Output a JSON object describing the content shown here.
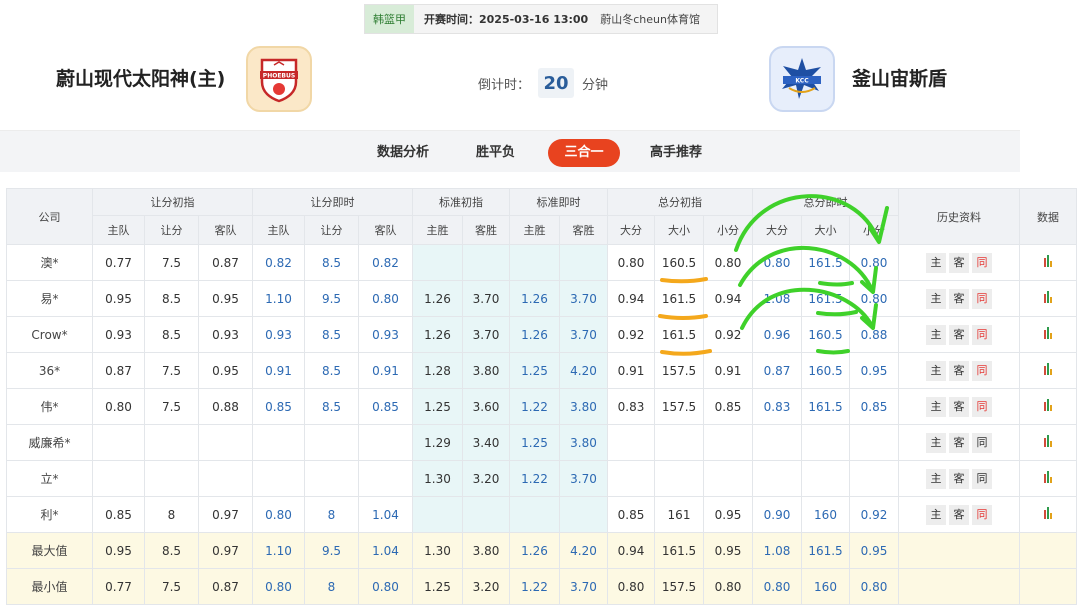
{
  "match": {
    "league": "韩篮甲",
    "start_label": "开赛时间：",
    "start_time": "2025-03-16 13:00",
    "venue": "蔚山冬cheun体育馆"
  },
  "teams": {
    "home": {
      "name": "蔚山现代太阳神(主)",
      "logo_text": "PHOEBUS"
    },
    "away": {
      "name": "釜山宙斯盾",
      "logo_text": "KCC"
    }
  },
  "countdown": {
    "label": "倒计时：",
    "value": "20",
    "unit": "分钟"
  },
  "tabs": [
    {
      "label": "数据分析",
      "active": false
    },
    {
      "label": "胜平负",
      "active": false
    },
    {
      "label": "三合一",
      "active": true
    },
    {
      "label": "高手推荐",
      "active": false
    }
  ],
  "table": {
    "group_headers": {
      "company": "公司",
      "handicap_open": "让分初指",
      "handicap_live": "让分即时",
      "std_open": "标准初指",
      "std_live": "标准即时",
      "total_open": "总分初指",
      "total_live": "总分即时",
      "history": "历史资料",
      "data": "数据"
    },
    "sub_headers": [
      "主队",
      "让分",
      "客队",
      "主队",
      "让分",
      "客队",
      "主胜",
      "客胜",
      "主胜",
      "客胜",
      "大分",
      "大小",
      "小分",
      "大分",
      "大小",
      "小分"
    ],
    "history_buttons": [
      "主",
      "客",
      "同"
    ],
    "rows": [
      {
        "company": "澳*",
        "hc_open": [
          "0.77",
          "7.5",
          "0.87"
        ],
        "hc_live": [
          "0.82",
          "8.5",
          "0.82"
        ],
        "std_open": [
          "",
          ""
        ],
        "std_live": [
          "",
          ""
        ],
        "tot_open": [
          "0.80",
          "160.5",
          "0.80"
        ],
        "tot_live": [
          "0.80",
          "161.5",
          "0.80"
        ],
        "same_active": true
      },
      {
        "company": "易*",
        "hc_open": [
          "0.95",
          "8.5",
          "0.95"
        ],
        "hc_live": [
          "1.10",
          "9.5",
          "0.80"
        ],
        "std_open": [
          "1.26",
          "3.70"
        ],
        "std_live": [
          "1.26",
          "3.70"
        ],
        "tot_open": [
          "0.94",
          "161.5",
          "0.94"
        ],
        "tot_live": [
          "1.08",
          "161.5",
          "0.80"
        ],
        "same_active": true
      },
      {
        "company": "Crow*",
        "hc_open": [
          "0.93",
          "8.5",
          "0.93"
        ],
        "hc_live": [
          "0.93",
          "8.5",
          "0.93"
        ],
        "std_open": [
          "1.26",
          "3.70"
        ],
        "std_live": [
          "1.26",
          "3.70"
        ],
        "tot_open": [
          "0.92",
          "161.5",
          "0.92"
        ],
        "tot_live": [
          "0.96",
          "160.5",
          "0.88"
        ],
        "same_active": true
      },
      {
        "company": "36*",
        "hc_open": [
          "0.87",
          "7.5",
          "0.95"
        ],
        "hc_live": [
          "0.91",
          "8.5",
          "0.91"
        ],
        "std_open": [
          "1.28",
          "3.80"
        ],
        "std_live": [
          "1.25",
          "4.20"
        ],
        "tot_open": [
          "0.91",
          "157.5",
          "0.91"
        ],
        "tot_live": [
          "0.87",
          "160.5",
          "0.95"
        ],
        "same_active": true
      },
      {
        "company": "伟*",
        "hc_open": [
          "0.80",
          "7.5",
          "0.88"
        ],
        "hc_live": [
          "0.85",
          "8.5",
          "0.85"
        ],
        "std_open": [
          "1.25",
          "3.60"
        ],
        "std_live": [
          "1.22",
          "3.80"
        ],
        "tot_open": [
          "0.83",
          "157.5",
          "0.85"
        ],
        "tot_live": [
          "0.83",
          "161.5",
          "0.85"
        ],
        "same_active": true
      },
      {
        "company": "威廉希*",
        "hc_open": [
          "",
          "",
          ""
        ],
        "hc_live": [
          "",
          "",
          ""
        ],
        "std_open": [
          "1.29",
          "3.40"
        ],
        "std_live": [
          "1.25",
          "3.80"
        ],
        "tot_open": [
          "",
          "",
          ""
        ],
        "tot_live": [
          "",
          "",
          ""
        ],
        "same_active": false
      },
      {
        "company": "立*",
        "hc_open": [
          "",
          "",
          ""
        ],
        "hc_live": [
          "",
          "",
          ""
        ],
        "std_open": [
          "1.30",
          "3.20"
        ],
        "std_live": [
          "1.22",
          "3.70"
        ],
        "tot_open": [
          "",
          "",
          ""
        ],
        "tot_live": [
          "",
          "",
          ""
        ],
        "same_active": false
      },
      {
        "company": "利*",
        "hc_open": [
          "0.85",
          "8",
          "0.97"
        ],
        "hc_live": [
          "0.80",
          "8",
          "1.04"
        ],
        "std_open": [
          "",
          ""
        ],
        "std_live": [
          "",
          ""
        ],
        "tot_open": [
          "0.85",
          "161",
          "0.95"
        ],
        "tot_live": [
          "0.90",
          "160",
          "0.92"
        ],
        "same_active": true
      }
    ],
    "summary_rows": [
      {
        "label": "最大值",
        "hc_open": [
          "0.95",
          "8.5",
          "0.97"
        ],
        "hc_live": [
          "1.10",
          "9.5",
          "1.04"
        ],
        "std_open": [
          "1.30",
          "3.80"
        ],
        "std_live": [
          "1.26",
          "4.20"
        ],
        "tot_open": [
          "0.94",
          "161.5",
          "0.95"
        ],
        "tot_live": [
          "1.08",
          "161.5",
          "0.95"
        ]
      },
      {
        "label": "最小值",
        "hc_open": [
          "0.77",
          "7.5",
          "0.87"
        ],
        "hc_live": [
          "0.80",
          "8",
          "0.80"
        ],
        "std_open": [
          "1.25",
          "3.20"
        ],
        "std_live": [
          "1.22",
          "3.70"
        ],
        "tot_open": [
          "0.80",
          "157.5",
          "0.80"
        ],
        "tot_live": [
          "0.80",
          "160",
          "0.80"
        ]
      }
    ]
  },
  "colors": {
    "accent_tab": "#e8431f",
    "live_value_blue": "#2c69b3",
    "std_column_bg": "#e8f6f7",
    "summary_bg": "#fdf9e3",
    "annotation_green": "#3fd12a",
    "annotation_orange": "#f4a81c"
  },
  "icons": {
    "history_same": "same-history-button",
    "data_chart": "bar-chart-icon"
  }
}
